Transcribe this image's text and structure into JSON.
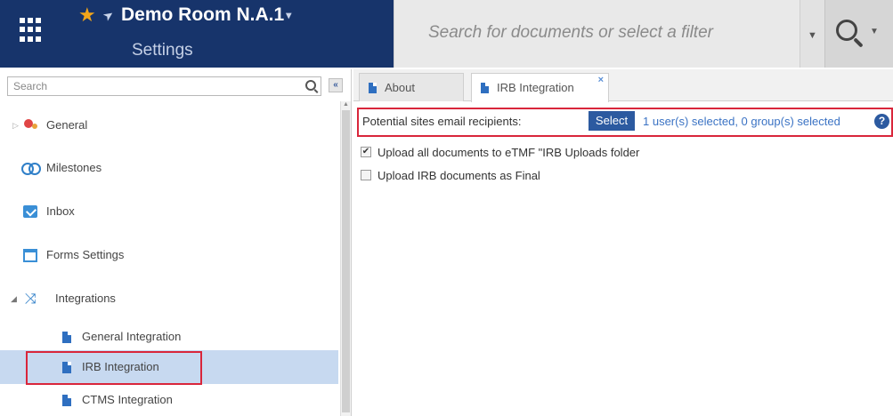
{
  "header": {
    "room_title": "Demo Room N.A.1",
    "room_caret": "▾",
    "room_subtitle": "Settings",
    "search_placeholder": "Search for documents or select a filter"
  },
  "sidebar": {
    "search_placeholder": "Search",
    "collapse_label": "«",
    "items": [
      {
        "label": "General"
      },
      {
        "label": "Milestones"
      },
      {
        "label": "Inbox"
      },
      {
        "label": "Forms Settings"
      },
      {
        "label": "Integrations"
      },
      {
        "label": "General Integration"
      },
      {
        "label": "IRB Integration"
      },
      {
        "label": "CTMS Integration"
      }
    ]
  },
  "tabs": [
    {
      "label": "About"
    },
    {
      "label": "IRB Integration",
      "close": "×"
    }
  ],
  "main": {
    "recipients_label": "Potential sites email recipients:",
    "select_button": "Select",
    "recipients_status": "1 user(s) selected, 0 group(s) selected",
    "help": "?",
    "options": [
      {
        "label": "Upload all documents to eTMF \"IRB Uploads folder",
        "checked": true
      },
      {
        "label": "Upload IRB documents as Final",
        "checked": false
      }
    ]
  },
  "colors": {
    "header_bg": "#17346b",
    "accent": "#2c5aa0",
    "highlight": "#d9263b",
    "selected_row": "#c7d9f0"
  }
}
